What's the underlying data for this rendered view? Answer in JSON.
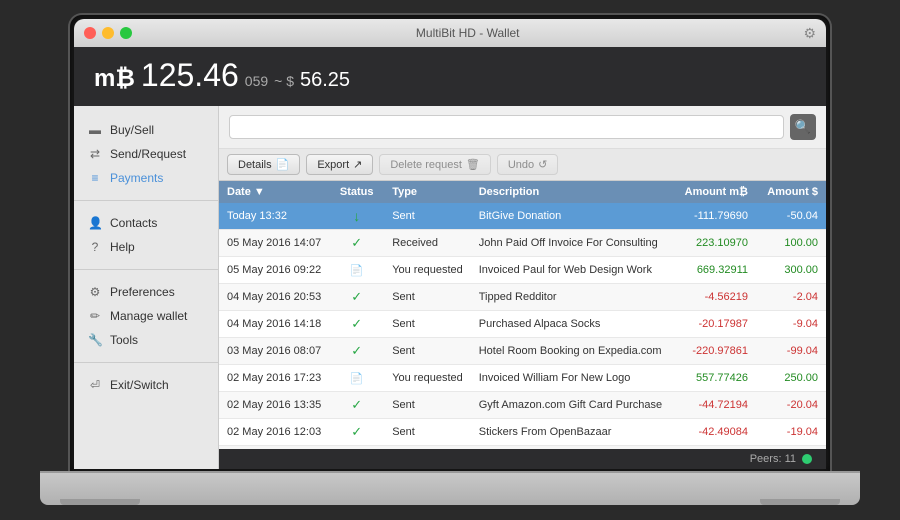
{
  "window": {
    "title": "MultiBit HD - Wallet",
    "trafficLights": [
      "close",
      "minimize",
      "maximize"
    ]
  },
  "header": {
    "balance_btc": "125.46",
    "balance_btc_small": "059",
    "balance_separator": "~ $",
    "balance_usd": "56.25",
    "currency_symbol": "mB"
  },
  "sidebar": {
    "items": [
      {
        "id": "buy-sell",
        "label": "Buy/Sell",
        "icon": "💳"
      },
      {
        "id": "send-request",
        "label": "Send/Request",
        "icon": "⇄"
      },
      {
        "id": "payments",
        "label": "Payments",
        "icon": "≡",
        "active": true
      }
    ],
    "divider1": true,
    "items2": [
      {
        "id": "contacts",
        "label": "Contacts",
        "icon": "👤"
      },
      {
        "id": "help",
        "label": "Help",
        "icon": "?"
      }
    ],
    "divider2": true,
    "items3": [
      {
        "id": "preferences",
        "label": "Preferences",
        "icon": "⚙"
      },
      {
        "id": "manage-wallet",
        "label": "Manage wallet",
        "icon": "✏"
      },
      {
        "id": "tools",
        "label": "Tools",
        "icon": "🔧"
      }
    ],
    "divider3": true,
    "items4": [
      {
        "id": "exit-switch",
        "label": "Exit/Switch",
        "icon": "⏎"
      }
    ]
  },
  "toolbar": {
    "details_label": "Details",
    "export_label": "Export",
    "delete_label": "Delete request",
    "undo_label": "Undo"
  },
  "search": {
    "placeholder": "",
    "button_icon": "🔍"
  },
  "table": {
    "columns": [
      "Date ▼",
      "Status",
      "Type",
      "Description",
      "Amount mB",
      "Amount $"
    ],
    "rows": [
      {
        "date": "Today 13:32",
        "status": "arrow",
        "type": "Sent",
        "description": "BitGive Donation",
        "amount_btc": "-111.79690",
        "amount_usd": "-50.04",
        "selected": true,
        "amount_btc_class": "negative",
        "amount_usd_class": "negative"
      },
      {
        "date": "05 May 2016 14:07",
        "status": "check",
        "type": "Received",
        "description": "John Paid Off Invoice For Consulting",
        "amount_btc": "223.10970",
        "amount_usd": "100.00",
        "selected": false,
        "amount_btc_class": "positive",
        "amount_usd_class": "positive"
      },
      {
        "date": "05 May 2016 09:22",
        "status": "doc",
        "type": "You requested",
        "description": "Invoiced Paul for Web Design Work",
        "amount_btc": "669.32911",
        "amount_usd": "300.00",
        "selected": false,
        "amount_btc_class": "positive",
        "amount_usd_class": "positive"
      },
      {
        "date": "04 May 2016 20:53",
        "status": "check",
        "type": "Sent",
        "description": "Tipped Redditor",
        "amount_btc": "-4.56219",
        "amount_usd": "-2.04",
        "selected": false,
        "amount_btc_class": "negative",
        "amount_usd_class": "negative"
      },
      {
        "date": "04 May 2016 14:18",
        "status": "check",
        "type": "Sent",
        "description": "Purchased Alpaca Socks",
        "amount_btc": "-20.17987",
        "amount_usd": "-9.04",
        "selected": false,
        "amount_btc_class": "negative",
        "amount_usd_class": "negative"
      },
      {
        "date": "03 May 2016 08:07",
        "status": "check",
        "type": "Sent",
        "description": "Hotel Room Booking on Expedia.com",
        "amount_btc": "-220.97861",
        "amount_usd": "-99.04",
        "selected": false,
        "amount_btc_class": "negative",
        "amount_usd_class": "negative"
      },
      {
        "date": "02 May 2016 17:23",
        "status": "doc",
        "type": "You requested",
        "description": "Invoiced William For New Logo",
        "amount_btc": "557.77426",
        "amount_usd": "250.00",
        "selected": false,
        "amount_btc_class": "positive",
        "amount_usd_class": "positive"
      },
      {
        "date": "02 May 2016 13:35",
        "status": "check",
        "type": "Sent",
        "description": "Gyft Amazon.com Gift Card Purchase",
        "amount_btc": "-44.72194",
        "amount_usd": "-20.04",
        "selected": false,
        "amount_btc_class": "negative",
        "amount_usd_class": "negative"
      },
      {
        "date": "02 May 2016 12:03",
        "status": "check",
        "type": "Sent",
        "description": "Stickers From OpenBazaar",
        "amount_btc": "-42.49084",
        "amount_usd": "-19.04",
        "selected": false,
        "amount_btc_class": "negative",
        "amount_usd_class": "negative"
      }
    ]
  },
  "footer": {
    "peers_label": "Peers: 11",
    "peers_count": 11
  }
}
